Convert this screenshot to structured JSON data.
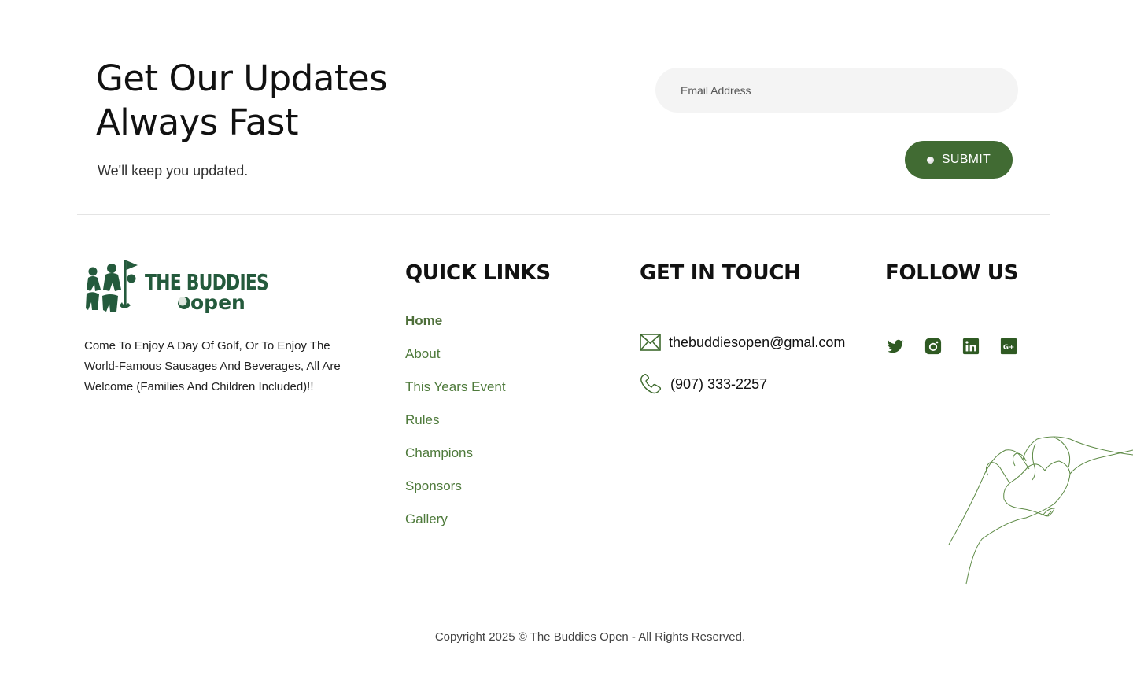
{
  "newsletter": {
    "title_line1": "Get Our Updates",
    "title_line2": "Always Fast",
    "subtitle": "We'll keep you updated.",
    "email_placeholder": "Email Address",
    "submit_label": "SUBMIT"
  },
  "brand": {
    "logo_line1": "THE BUDDIES",
    "logo_line2": "open",
    "description": "Come To Enjoy A Day Of Golf, Or To Enjoy The World-Famous Sausages And Beverages, All Are Welcome (Families And Children Included)!!"
  },
  "quick_links": {
    "heading": "QUICK LINKS",
    "items": [
      {
        "label": "Home",
        "active": true
      },
      {
        "label": "About"
      },
      {
        "label": "This Years Event"
      },
      {
        "label": "Rules"
      },
      {
        "label": "Champions"
      },
      {
        "label": "Sponsors"
      },
      {
        "label": "Gallery"
      }
    ]
  },
  "contact": {
    "heading": "GET IN TOUCH",
    "email": "thebuddiesopen@gmal.com",
    "phone": "(907) 333-2257",
    "email_icon": "mail-icon",
    "phone_icon": "phone-icon"
  },
  "follow": {
    "heading": "FOLLOW US",
    "icons": [
      "twitter-icon",
      "instagram-icon",
      "linkedin-icon",
      "google-plus-icon"
    ]
  },
  "copyright": "Copyright 2025 © The Buddies Open - All Rights Reserved.",
  "colors": {
    "brand_green": "#416b33",
    "link_green": "#4e7a3b",
    "logo_green": "#245a3c",
    "input_bg": "#f4f4f4"
  }
}
